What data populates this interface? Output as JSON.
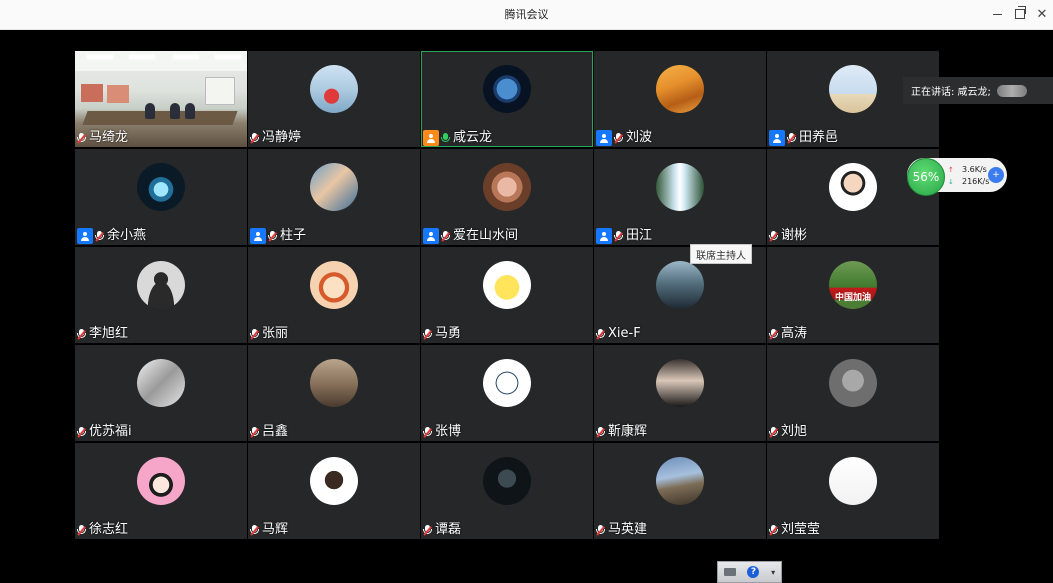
{
  "window": {
    "title": "腾讯会议",
    "minimize_icon": "minimize-icon",
    "restore_icon": "restore-icon",
    "close_glyph": "✕"
  },
  "speaking": {
    "label": "正在讲话: 咸云龙;"
  },
  "network": {
    "percent": "56%",
    "up_arrow": "↑",
    "up": "3.6K/s",
    "down_arrow": "↓",
    "down": "216K/s",
    "boost_glyph": "+"
  },
  "tooltip": {
    "text": "联席主持人"
  },
  "toolbar": {
    "help_glyph": "?",
    "dropdown_glyph": "▾"
  },
  "colors": {
    "active_border": "#27a75a",
    "host_badge": "#1677ff",
    "self_badge": "#ff8a1c",
    "tile_bg": "#252729"
  },
  "participants": [
    {
      "name": "马绮龙",
      "badge": "none",
      "mic": "muted",
      "video": "camera"
    },
    {
      "name": "冯静婷",
      "badge": "none",
      "mic": "muted",
      "avatar": "girl-sitting"
    },
    {
      "name": "咸云龙",
      "badge": "self",
      "mic": "speaking",
      "avatar": "earth",
      "active": true
    },
    {
      "name": "刘波",
      "badge": "cohost",
      "mic": "muted",
      "avatar": "desert"
    },
    {
      "name": "田养邑",
      "badge": "cohost",
      "mic": "muted",
      "avatar": "kids-running"
    },
    {
      "name": "余小燕",
      "badge": "cohost",
      "mic": "muted",
      "avatar": "glowing-cup"
    },
    {
      "name": "柱子",
      "badge": "cohost",
      "mic": "muted",
      "avatar": "hands"
    },
    {
      "name": "爱在山水间",
      "badge": "cohost",
      "mic": "muted",
      "avatar": "flowers"
    },
    {
      "name": "田江",
      "badge": "cohost",
      "mic": "muted",
      "avatar": "waterfall"
    },
    {
      "name": "谢彬",
      "badge": "none",
      "mic": "muted",
      "avatar": "cartoon-man"
    },
    {
      "name": "李旭红",
      "badge": "none",
      "mic": "muted",
      "avatar": "default-person"
    },
    {
      "name": "张丽",
      "badge": "none",
      "mic": "muted",
      "avatar": "cartoon-girl"
    },
    {
      "name": "马勇",
      "badge": "none",
      "mic": "muted",
      "avatar": "yellow-duck"
    },
    {
      "name": "Xie-F",
      "badge": "none",
      "mic": "muted",
      "avatar": "man-portrait"
    },
    {
      "name": "高涛",
      "badge": "none",
      "mic": "muted",
      "avatar": "china-flag-field",
      "avatar_text": "中国加油"
    },
    {
      "name": "优苏福i",
      "badge": "none",
      "mic": "muted",
      "avatar": "bw-photo"
    },
    {
      "name": "吕鑫",
      "badge": "none",
      "mic": "muted",
      "avatar": "sunset-figure"
    },
    {
      "name": "张博",
      "badge": "none",
      "mic": "muted",
      "avatar": "line-face"
    },
    {
      "name": "靳康辉",
      "badge": "none",
      "mic": "muted",
      "avatar": "man-suit"
    },
    {
      "name": "刘旭",
      "badge": "none",
      "mic": "muted",
      "avatar": "gray-portrait"
    },
    {
      "name": "徐志红",
      "badge": "none",
      "mic": "muted",
      "avatar": "girl-bow"
    },
    {
      "name": "马辉",
      "badge": "none",
      "mic": "muted",
      "avatar": "man-smiling"
    },
    {
      "name": "谭磊",
      "badge": "none",
      "mic": "muted",
      "avatar": "dark-figure"
    },
    {
      "name": "马英建",
      "badge": "none",
      "mic": "muted",
      "avatar": "mountain-road"
    },
    {
      "name": "刘莹莹",
      "badge": "none",
      "mic": "muted",
      "avatar": "sketch"
    }
  ]
}
